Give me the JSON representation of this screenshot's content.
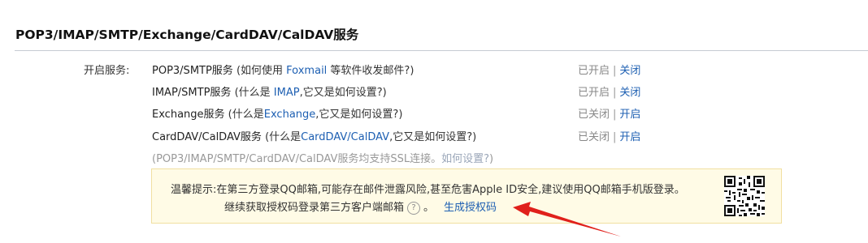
{
  "header": {
    "title": "POP3/IMAP/SMTP/Exchange/CardDAV/CalDAV服务"
  },
  "label": "开启服务:",
  "services": [
    {
      "name": "POP3/SMTP服务",
      "help_prefix": "(如何使用 ",
      "help_link": "Foxmail",
      "help_suffix": " 等软件收发邮件?)",
      "status": "已开启",
      "action": "关闭"
    },
    {
      "name": "IMAP/SMTP服务",
      "help_prefix": "(什么是 ",
      "help_link": "IMAP",
      "help_suffix": ",它又是如何设置?)",
      "status": "已开启",
      "action": "关闭"
    },
    {
      "name": "Exchange服务",
      "help_prefix": "(什么是",
      "help_link": "Exchange",
      "help_suffix": ",它又是如何设置?)",
      "status": "已关闭",
      "action": "开启"
    },
    {
      "name": "CardDAV/CalDAV服务",
      "help_prefix": "(什么是",
      "help_link": "CardDAV/CalDAV",
      "help_suffix": ",它又是如何设置?)",
      "status": "已关闭",
      "action": "开启"
    }
  ],
  "separator": "|",
  "ssl_note": "(POP3/IMAP/SMTP/CardDAV/CalDAV服务均支持SSL连接。",
  "ssl_link": "如何设置?",
  "ssl_close": ")",
  "tip": {
    "line1": "温馨提示:在第三方登录QQ邮箱,可能存在邮件泄露风险,甚至危害Apple ID安全,建议使用QQ邮箱手机版登录。",
    "line2": "继续获取授权码登录第三方客户端邮箱",
    "help_icon": "?",
    "end": "。",
    "generate_link": "生成授权码",
    "qr_icon": "qr-code-icon"
  },
  "colors": {
    "link": "#1d5fb2",
    "tip_bg": "#fffbe6",
    "arrow": "#e0201b"
  }
}
